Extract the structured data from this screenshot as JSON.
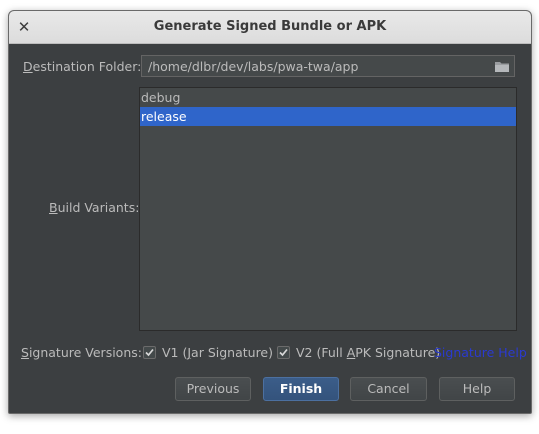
{
  "window": {
    "title": "Generate Signed Bundle or APK",
    "close_glyph": "✕"
  },
  "destination": {
    "label": "Destination Folder:",
    "mnemonic": "D",
    "label_rest": "estination Folder:",
    "value": "/home/dlbr/dev/labs/pwa-twa/app",
    "browse_icon": "folder-icon"
  },
  "build_variants": {
    "label": "Build Variants:",
    "mnemonic": "B",
    "label_rest": "uild Variants:",
    "items": [
      {
        "label": "debug",
        "selected": false
      },
      {
        "label": "release",
        "selected": true
      }
    ]
  },
  "signature": {
    "label": "Signature Versions:",
    "mnemonic": "S",
    "label_rest": "ignature Versions:",
    "v1": {
      "label": "V1 (Jar Signature)",
      "checked": true,
      "pre": "V1 (",
      "mnemonic": "J",
      "post": "ar Signature)"
    },
    "v2": {
      "label": "V2 (Full APK Signature)",
      "checked": true,
      "pre": "V2 (Full ",
      "mnemonic": "A",
      "post": "PK Signature)"
    },
    "help_link": "Signature Help"
  },
  "buttons": {
    "previous": "Previous",
    "finish": "Finish",
    "cancel": "Cancel",
    "help": "Help"
  },
  "colors": {
    "dialog_bg": "#3c3f41",
    "selection": "#2f65ca",
    "link": "#2a3ad0",
    "default_button": "#365880"
  }
}
